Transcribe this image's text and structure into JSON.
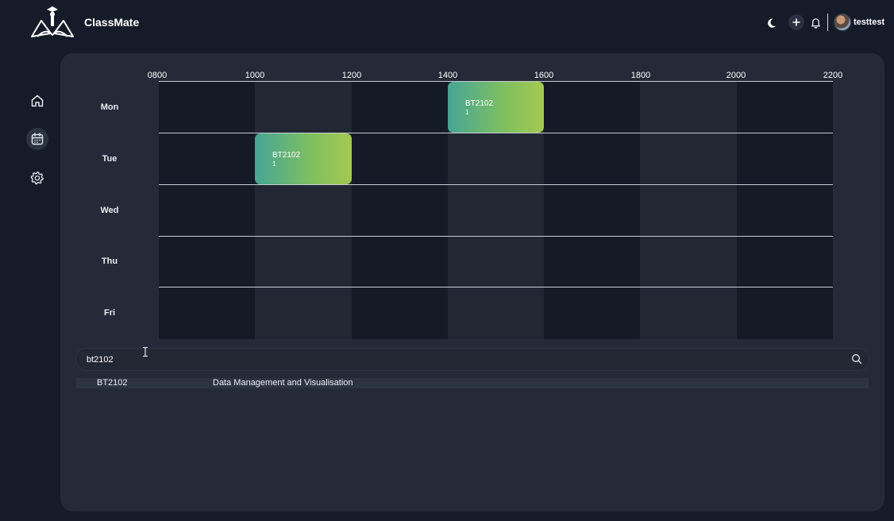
{
  "app": {
    "brand": "ClassMate"
  },
  "header": {
    "icons": [
      "logo-icon",
      "moon-icon",
      "plus-icon",
      "bell-icon"
    ],
    "username": "testtest"
  },
  "sidebar": {
    "items": [
      {
        "icon": "home-icon",
        "active": false
      },
      {
        "icon": "calendar-icon",
        "active": true
      },
      {
        "icon": "gear-icon",
        "active": false
      }
    ]
  },
  "timetable": {
    "times": [
      "0800",
      "1000",
      "1200",
      "1400",
      "1600",
      "1800",
      "2000",
      "2200"
    ],
    "days": [
      "Mon",
      "Tue",
      "Wed",
      "Thu",
      "Fri"
    ],
    "events": [
      {
        "code": "BT2102",
        "sub": "1",
        "day": "Mon",
        "start": "1400",
        "end": "1600"
      },
      {
        "code": "BT2102",
        "sub": "1",
        "day": "Tue",
        "start": "1000",
        "end": "1200"
      }
    ]
  },
  "search": {
    "value": "bt2102"
  },
  "results": [
    {
      "code": "BT2102",
      "name": "Data Management and Visualisation"
    }
  ],
  "colors": {
    "background": "#151b28",
    "panel": "#242a37",
    "event_gradient_start": "#46a594",
    "event_gradient_end": "#a4c950"
  }
}
